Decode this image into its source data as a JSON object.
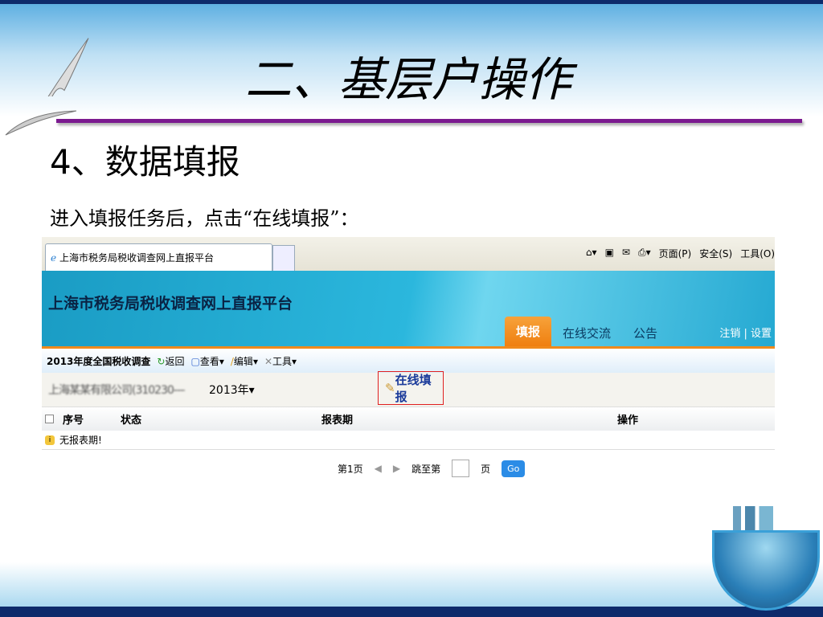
{
  "slide": {
    "title": "二、基层户操作",
    "section": "4、数据填报",
    "instruction": "进入填报任务后，点击“在线填报”："
  },
  "browser": {
    "tab_title": "上海市税务局税收调查网上直报平台",
    "menu": [
      "页面(P)",
      "安全(S)",
      "工具(O)"
    ]
  },
  "app": {
    "title": "上海市税务局税收调查网上直报平台",
    "nav": [
      "填报",
      "在线交流",
      "公告"
    ],
    "links": [
      "注销",
      "设置"
    ],
    "toolbar": {
      "survey": "2013年度全国税收调查",
      "back": "返回",
      "view": "查看",
      "edit": "编辑",
      "tools": "工具"
    },
    "company": "上海某某有限公司(310230-------)",
    "year": "2013年",
    "online_fill": "在线填报",
    "columns": [
      "序号",
      "状态",
      "报表期",
      "操作"
    ],
    "empty_msg": "无报表期!",
    "pager": {
      "page": "第1页",
      "jump": "跳至第",
      "unit": "页",
      "go": "Go"
    }
  },
  "colors": {
    "accent": "#f08a1c",
    "rule": "#7b1a8f",
    "banner": "#1a9cc4"
  }
}
